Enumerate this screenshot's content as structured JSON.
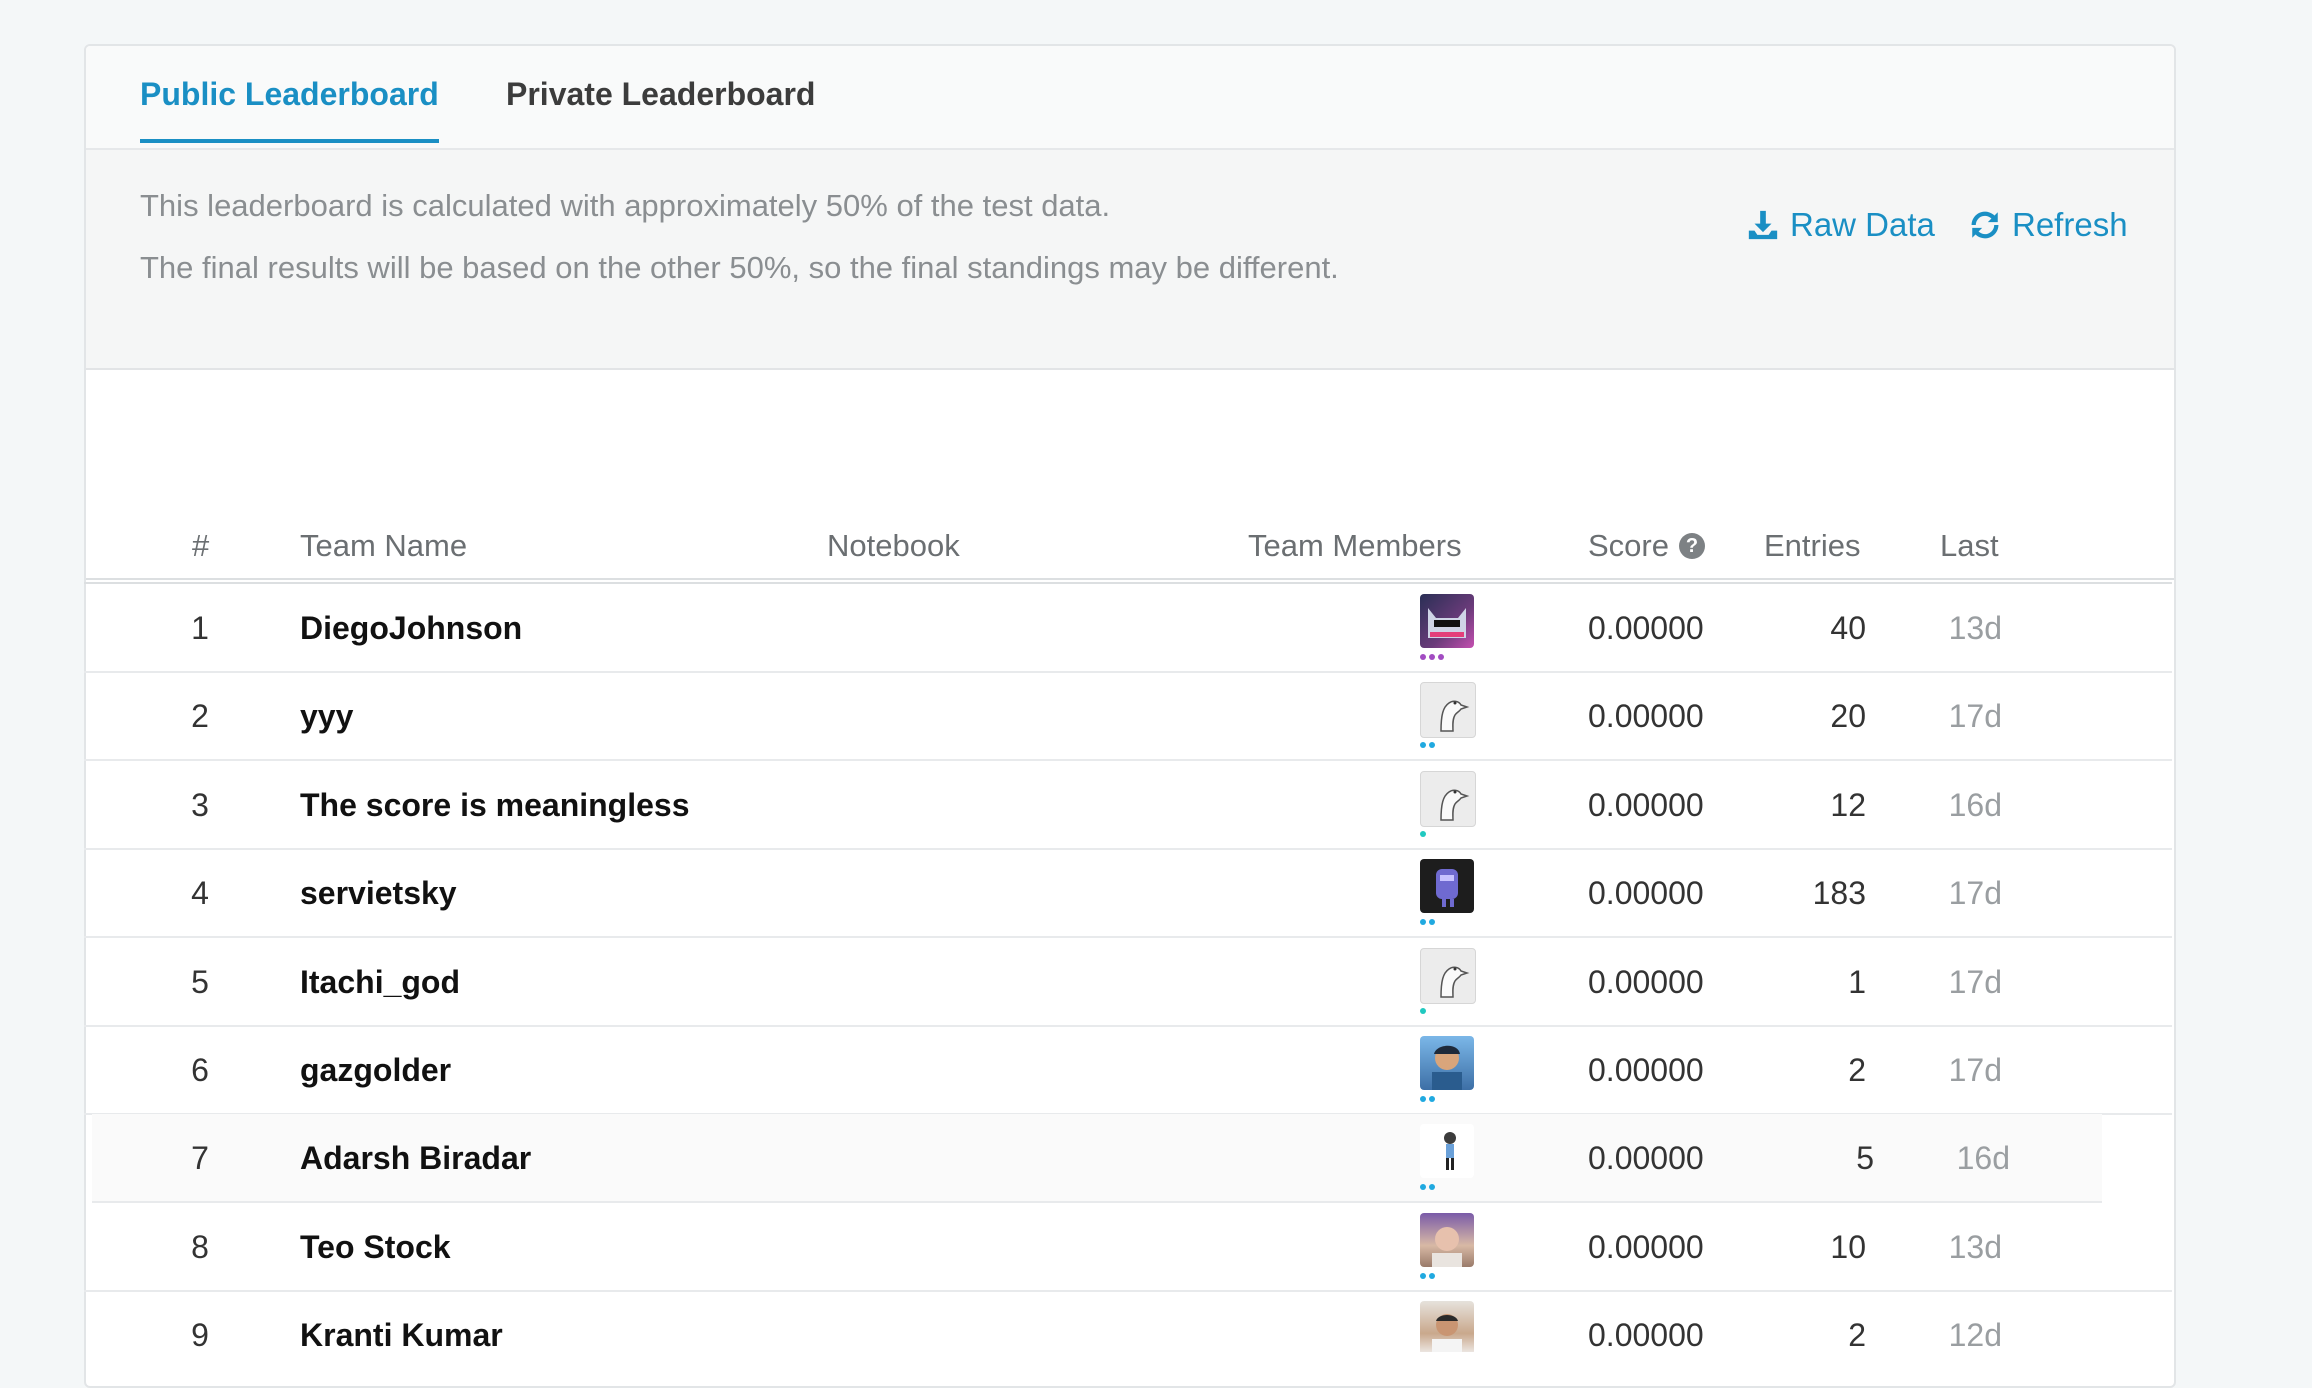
{
  "tabs": [
    {
      "label": "Public Leaderboard",
      "active": true
    },
    {
      "label": "Private Leaderboard",
      "active": false
    }
  ],
  "notice": {
    "line1": "This leaderboard is calculated with approximately 50% of the test data.",
    "line2": "The final results will be based on the other 50%, so the final standings may be different."
  },
  "actions": {
    "raw_data": "Raw Data",
    "refresh": "Refresh"
  },
  "columns": {
    "rank": "#",
    "team_name": "Team Name",
    "notebook": "Notebook",
    "team_members": "Team Members",
    "score": "Score",
    "entries": "Entries",
    "last": "Last"
  },
  "rows": [
    {
      "rank": "1",
      "team": "DiegoJohnson",
      "score": "0.00000",
      "entries": "40",
      "last": "13d",
      "avatar": "cat-with-sunglasses-avatar",
      "dot_color": "#a24cc2",
      "dots": 3
    },
    {
      "rank": "2",
      "team": "yyy",
      "score": "0.00000",
      "entries": "20",
      "last": "17d",
      "avatar": "goose-sketch-avatar",
      "dot_color": "#20a9e0",
      "dots": 2
    },
    {
      "rank": "3",
      "team": "The score is meaningless",
      "score": "0.00000",
      "entries": "12",
      "last": "16d",
      "avatar": "goose-sketch-avatar",
      "dot_color": "#20c9c0",
      "dots": 1
    },
    {
      "rank": "4",
      "team": "servietsky",
      "score": "0.00000",
      "entries": "183",
      "last": "17d",
      "avatar": "purple-character-avatar",
      "dot_color": "#20a9e0",
      "dots": 2
    },
    {
      "rank": "5",
      "team": "Itachi_god",
      "score": "0.00000",
      "entries": "1",
      "last": "17d",
      "avatar": "goose-sketch-avatar",
      "dot_color": "#20c9c0",
      "dots": 1
    },
    {
      "rank": "6",
      "team": "gazgolder",
      "score": "0.00000",
      "entries": "2",
      "last": "17d",
      "avatar": "cartoon-person-avatar",
      "dot_color": "#20a9e0",
      "dots": 2
    },
    {
      "rank": "7",
      "team": "Adarsh Biradar",
      "score": "0.00000",
      "entries": "5",
      "last": "16d",
      "avatar": "small-figure-avatar",
      "dot_color": "#20a9e0",
      "dots": 2
    },
    {
      "rank": "8",
      "team": "Teo Stock",
      "score": "0.00000",
      "entries": "10",
      "last": "13d",
      "avatar": "photo-person-avatar",
      "dot_color": "#20a9e0",
      "dots": 2
    },
    {
      "rank": "9",
      "team": "Kranti Kumar",
      "score": "0.00000",
      "entries": "2",
      "last": "12d",
      "avatar": "photo-man-avatar",
      "dot_color": "#20a9e0",
      "dots": 2
    }
  ],
  "colors": {
    "accent": "#1a8fc4",
    "muted_text": "#8a8e91"
  }
}
